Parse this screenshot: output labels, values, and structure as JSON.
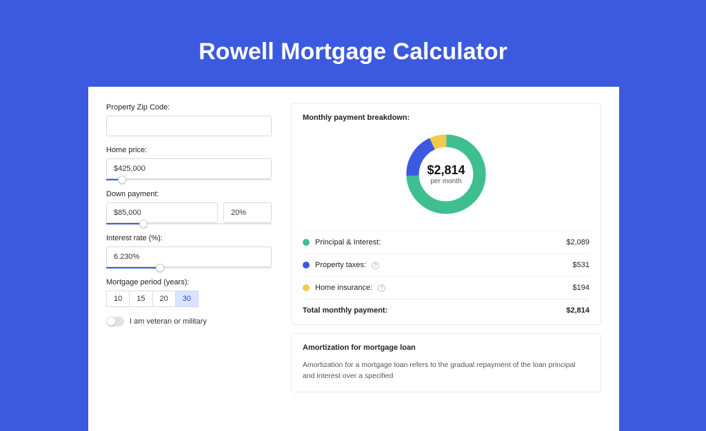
{
  "title": "Rowell Mortgage Calculator",
  "colors": {
    "principal": "#3fbf8f",
    "taxes": "#3b5ae0",
    "insurance": "#f4c94b"
  },
  "form": {
    "zip_label": "Property Zip Code:",
    "zip_value": "",
    "price_label": "Home price:",
    "price_value": "$425,000",
    "price_slider_pct": 7,
    "down_label": "Down payment:",
    "down_value": "$85,000",
    "down_pct_value": "20%",
    "down_slider_pct": 20,
    "rate_label": "Interest rate (%):",
    "rate_value": "6.230%",
    "rate_slider_pct": 30,
    "period_label": "Mortgage period (years):",
    "periods": {
      "p10": "10",
      "p15": "15",
      "p20": "20",
      "p30": "30"
    },
    "period_active": "30",
    "veteran_label": "I am veteran or military"
  },
  "breakdown": {
    "title": "Monthly payment breakdown:",
    "center_value": "$2,814",
    "center_sub": "per month",
    "rows": {
      "principal": {
        "label": "Principal & Interest:",
        "value": "$2,089"
      },
      "taxes": {
        "label": "Property taxes:",
        "value": "$531"
      },
      "insurance": {
        "label": "Home insurance:",
        "value": "$194"
      }
    },
    "total_label": "Total monthly payment:",
    "total_value": "$2,814"
  },
  "amortization": {
    "title": "Amortization for mortgage loan",
    "body": "Amortization for a mortgage loan refers to the gradual repayment of the loan principal and interest over a specified"
  },
  "chart_data": {
    "type": "pie",
    "title": "Monthly payment breakdown",
    "series": [
      {
        "name": "Principal & Interest",
        "value": 2089,
        "color": "#3fbf8f"
      },
      {
        "name": "Property taxes",
        "value": 531,
        "color": "#3b5ae0"
      },
      {
        "name": "Home insurance",
        "value": 194,
        "color": "#f4c94b"
      }
    ],
    "total": 2814
  }
}
